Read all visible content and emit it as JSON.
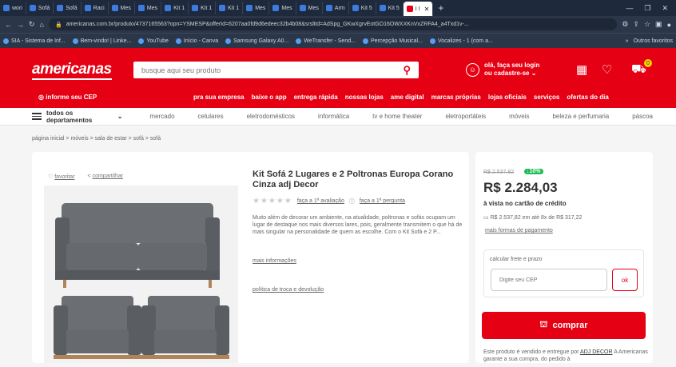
{
  "browser": {
    "tabs": [
      "wori",
      "Sofá",
      "Sofá",
      "Raci",
      "Mes",
      "Mes",
      "Kit 1",
      "Kit 1",
      "Kit 1",
      "Mes",
      "Mes",
      "Mes",
      "Arm",
      "Kit 5",
      "Kit 5",
      "I I"
    ],
    "active_tab_index": 15,
    "url": "americanas.com.br/produto/4737165563?opn=YSMESP&offerId=6207aa0fd9d6edeec32b4b08&srsltid=AdSpg_GKwXgrvEotGO16OWXXKnVxZRFA4_a4Txd1v-...",
    "bookmarks": [
      "SIA - Sistema de Inf...",
      "Bem-vindo! | Linke...",
      "YouTube",
      "Início - Canva",
      "Samsung Galaxy A0...",
      "WeTransfer - Send...",
      "Percepção Musical...",
      "Vocalizes - 1 (com a..."
    ],
    "bookmarks_more": "»",
    "other_favorites": "Outros favoritos"
  },
  "header": {
    "logo": "americanas",
    "search_placeholder": "busque aqui seu produto",
    "login_line1": "olá, faça seu login",
    "login_line2": "ou cadastre-se ⌄",
    "cart_count": "0",
    "cep": "◎ informe seu CEP",
    "nav_links": [
      "pra sua empresa",
      "baixe o app",
      "entrega rápida",
      "nossas lojas",
      "ame digital",
      "marcas próprias",
      "lojas oficiais",
      "serviços",
      "ofertas do dia"
    ]
  },
  "categories": {
    "departments_label": "todos os departamentos",
    "items": [
      "mercado",
      "celulares",
      "eletrodomésticos",
      "informática",
      "tv e home theater",
      "eletroportáteis",
      "móveis",
      "beleza e perfumaria",
      "páscoa"
    ]
  },
  "breadcrumb": "página inicial  >  móveis  >  sala de estar  >  sofá  >  sofá",
  "product": {
    "favoritar": "favoritar",
    "compartilhar": "compartilhar",
    "title": "Kit Sofá 2 Lugares e 2 Poltronas Europa Corano Cinza adj Decor",
    "rating_link": "faça a 1ª avaliação",
    "question_link": "faça a 1ª pergunta",
    "description": "Muito além de decorar um ambiente, na atualidade, poltronas e sofás ocupam um lugar de destaque nos mais diversos lares, pois, geralmente transmitem o que há de mais singular na personalidade de quem as escolhe. Com o Kit Sofá e 2 P...",
    "more_info": "mais informações",
    "return_policy": "política de troca e devolução"
  },
  "buybox": {
    "old_price": "R$ 2.537,82",
    "discount": "↓10%",
    "price": "R$ 2.284,03",
    "payment_note": "à vista no cartão de crédito",
    "installments": "R$ 2.537,82 em até 8x de R$ 317,22",
    "more_payment": "mais formas de pagamento",
    "shipping_label": "calcular frete e prazo",
    "cep_placeholder": "Digite seu CEP",
    "ok_label": "ok",
    "buy_label": "comprar",
    "seller_prefix": "Este produto é vendido e entregue por",
    "seller": "ADJ DECOR",
    "seller_suffix": "A Americanas garante a sua compra, do pedido à"
  },
  "colors": {
    "brand": "#e60014",
    "discount": "#1db954"
  }
}
